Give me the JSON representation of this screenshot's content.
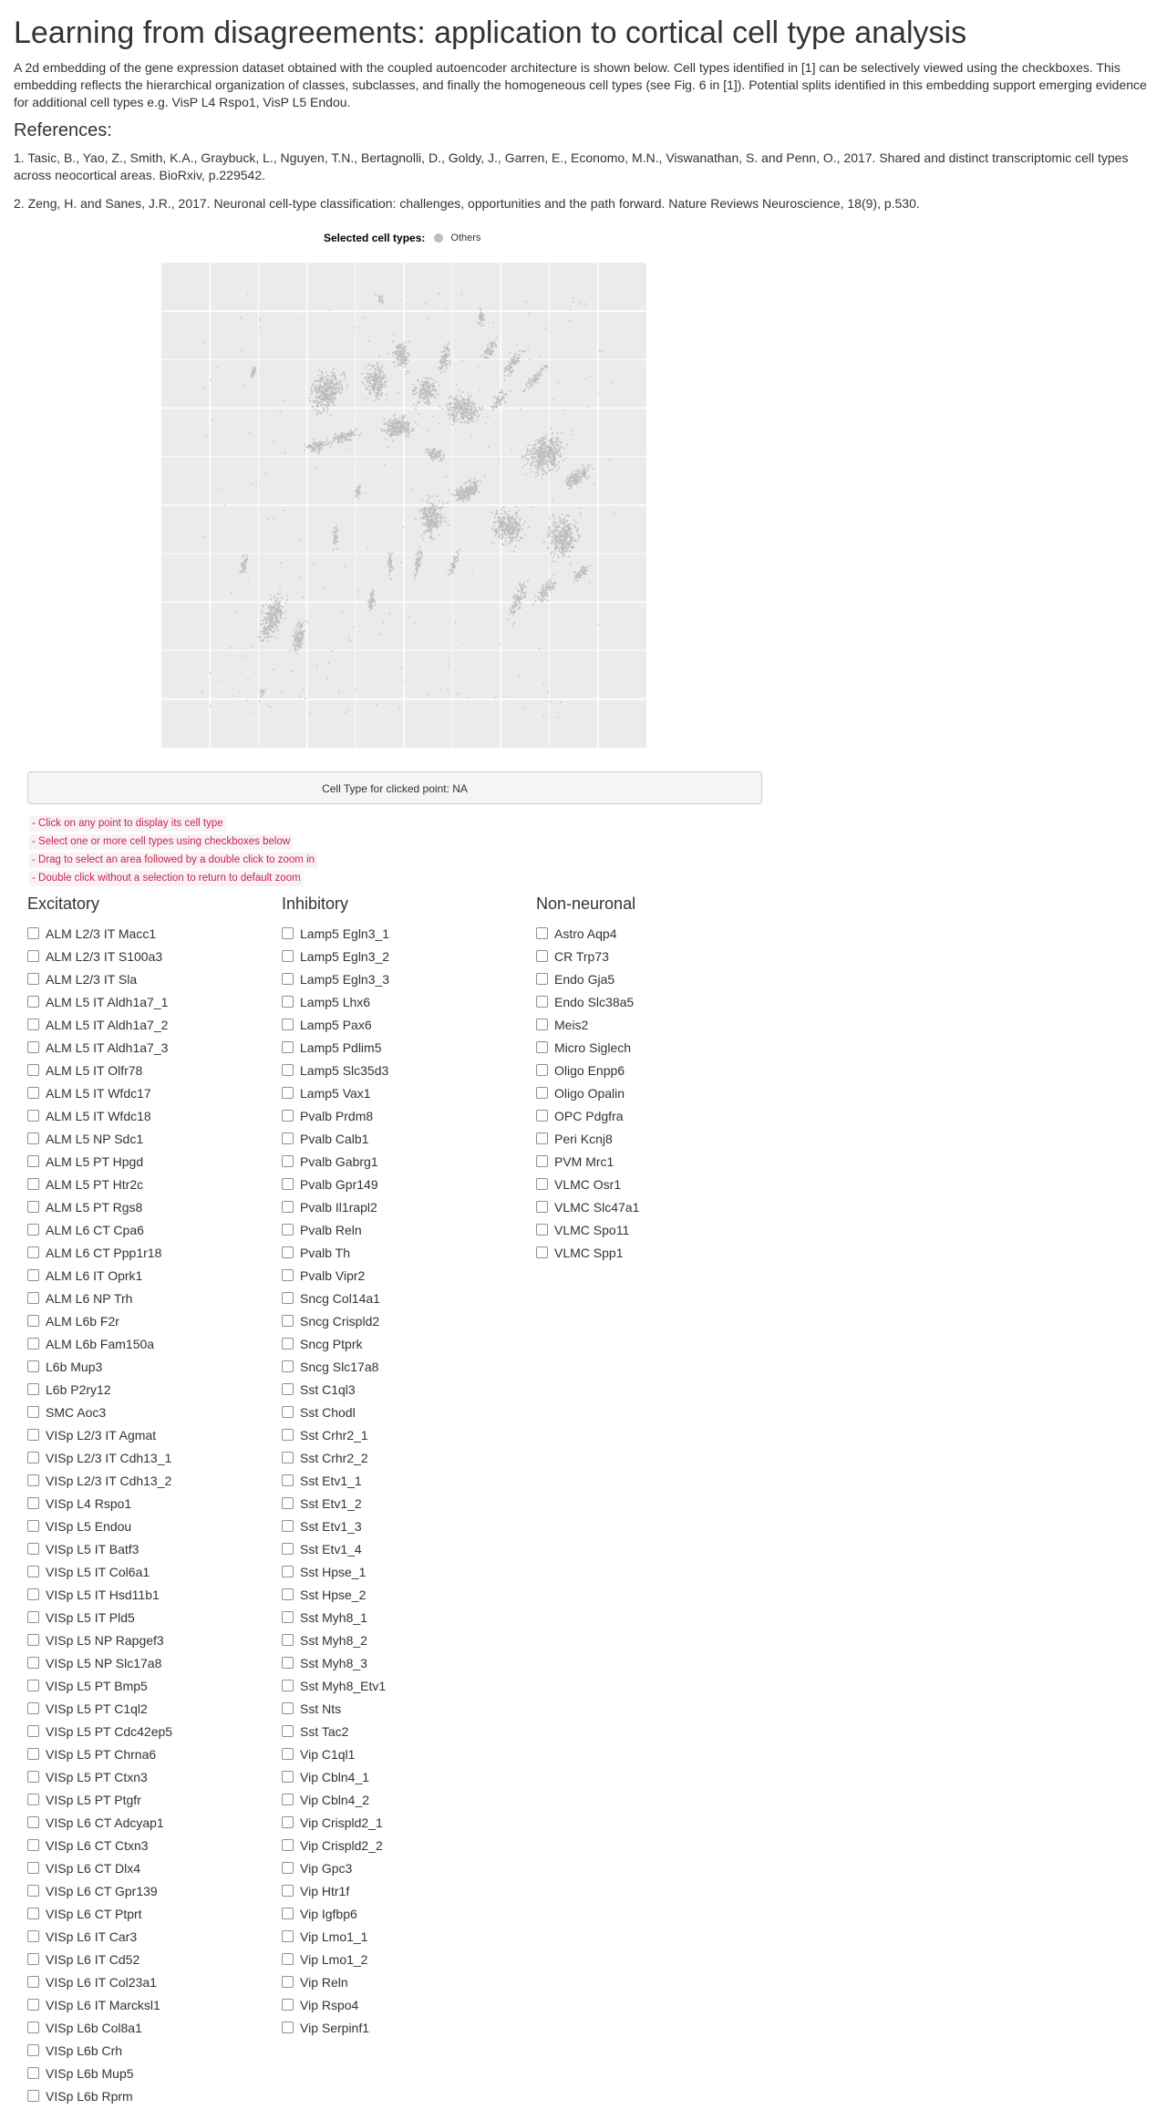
{
  "title": "Learning from disagreements: application to cortical cell type analysis",
  "intro": "A 2d embedding of the gene expression dataset obtained with the coupled autoencoder architecture is shown below. Cell types identified in [1] can be selectively viewed using the checkboxes. This embedding reflects the hierarchical organization of classes, subclasses, and finally the homogeneous cell types (see Fig. 6 in [1]). Potential splits identified in this embedding support emerging evidence for additional cell types e.g. VisP L4 Rspo1, VisP L5 Endou.",
  "references_heading": "References:",
  "references": [
    "1. Tasic, B., Yao, Z., Smith, K.A., Graybuck, L., Nguyen, T.N., Bertagnolli, D., Goldy, J., Garren, E., Economo, M.N., Viswanathan, S. and Penn, O., 2017. Shared and distinct transcriptomic cell types across neocortical areas. BioRxiv, p.229542.",
    "2. Zeng, H. and Sanes, J.R., 2017. Neuronal cell-type classification: challenges, opportunities and the path forward. Nature Reviews Neuroscience, 18(9), p.530."
  ],
  "legend": {
    "title": "Selected cell types:",
    "item": "Others",
    "item_color": "#bdbdbd"
  },
  "plot": {
    "background": "#ebebeb",
    "grid_color": "#ffffff",
    "point_color": "#bdbdbd"
  },
  "clicked_label": "Cell Type for clicked point: NA",
  "hints": [
    "- Click on any point to display its cell type",
    "- Select one or more cell types using checkboxes below",
    "- Drag to select an area followed by a double click to zoom in",
    "- Double click without a selection to return to default zoom"
  ],
  "groups": [
    {
      "heading": "Excitatory",
      "items": [
        "ALM L2/3 IT Macc1",
        "ALM L2/3 IT S100a3",
        "ALM L2/3 IT Sla",
        "ALM L5 IT Aldh1a7_1",
        "ALM L5 IT Aldh1a7_2",
        "ALM L5 IT Aldh1a7_3",
        "ALM L5 IT Olfr78",
        "ALM L5 IT Wfdc17",
        "ALM L5 IT Wfdc18",
        "ALM L5 NP Sdc1",
        "ALM L5 PT Hpgd",
        "ALM L5 PT Htr2c",
        "ALM L5 PT Rgs8",
        "ALM L6 CT Cpa6",
        "ALM L6 CT Ppp1r18",
        "ALM L6 IT Oprk1",
        "ALM L6 NP Trh",
        "ALM L6b F2r",
        "ALM L6b Fam150a",
        "L6b Mup3",
        "L6b P2ry12",
        "SMC Aoc3",
        "VISp L2/3 IT Agmat",
        "VISp L2/3 IT Cdh13_1",
        "VISp L2/3 IT Cdh13_2",
        "VISp L4 Rspo1",
        "VISp L5 Endou",
        "VISp L5 IT Batf3",
        "VISp L5 IT Col6a1",
        "VISp L5 IT Hsd11b1",
        "VISp L5 IT Pld5",
        "VISp L5 NP Rapgef3",
        "VISp L5 NP Slc17a8",
        "VISp L5 PT Bmp5",
        "VISp L5 PT C1ql2",
        "VISp L5 PT Cdc42ep5",
        "VISp L5 PT Chrna6",
        "VISp L5 PT Ctxn3",
        "VISp L5 PT Ptgfr",
        "VISp L6 CT Adcyap1",
        "VISp L6 CT Ctxn3",
        "VISp L6 CT Dlx4",
        "VISp L6 CT Gpr139",
        "VISp L6 CT Ptprt",
        "VISp L6 IT Car3",
        "VISp L6 IT Cd52",
        "VISp L6 IT Col23a1",
        "VISp L6 IT Marcksl1",
        "VISp L6b Col8a1",
        "VISp L6b Crh",
        "VISp L6b Mup5",
        "VISp L6b Rprm"
      ]
    },
    {
      "heading": "Inhibitory",
      "items": [
        "Lamp5 Egln3_1",
        "Lamp5 Egln3_2",
        "Lamp5 Egln3_3",
        "Lamp5 Lhx6",
        "Lamp5 Pax6",
        "Lamp5 Pdlim5",
        "Lamp5 Slc35d3",
        "Lamp5 Vax1",
        "Pvalb Prdm8",
        "Pvalb Calb1",
        "Pvalb Gabrg1",
        "Pvalb Gpr149",
        "Pvalb Il1rapl2",
        "Pvalb Reln",
        "Pvalb Th",
        "Pvalb Vipr2",
        "Sncg Col14a1",
        "Sncg Crispld2",
        "Sncg Ptprk",
        "Sncg Slc17a8",
        "Sst C1ql3",
        "Sst Chodl",
        "Sst Crhr2_1",
        "Sst Crhr2_2",
        "Sst Etv1_1",
        "Sst Etv1_2",
        "Sst Etv1_3",
        "Sst Etv1_4",
        "Sst Hpse_1",
        "Sst Hpse_2",
        "Sst Myh8_1",
        "Sst Myh8_2",
        "Sst Myh8_3",
        "Sst Myh8_Etv1",
        "Sst Nts",
        "Sst Tac2",
        "Vip C1ql1",
        "Vip Cbln4_1",
        "Vip Cbln4_2",
        "Vip Crispld2_1",
        "Vip Crispld2_2",
        "Vip Gpc3",
        "Vip Htr1f",
        "Vip Igfbp6",
        "Vip Lmo1_1",
        "Vip Lmo1_2",
        "Vip Reln",
        "Vip Rspo4",
        "Vip Serpinf1"
      ]
    },
    {
      "heading": "Non-neuronal",
      "items": [
        "Astro Aqp4",
        "CR Trp73",
        "Endo Gja5",
        "Endo Slc38a5",
        "Meis2",
        "Micro Siglech",
        "Oligo Enpp6",
        "Oligo Opalin",
        "OPC Pdgfra",
        "Peri Kcnj8",
        "PVM Mrc1",
        "VLMC Osr1",
        "VLMC Slc47a1",
        "VLMC Spo11",
        "VLMC Spp1"
      ]
    }
  ]
}
